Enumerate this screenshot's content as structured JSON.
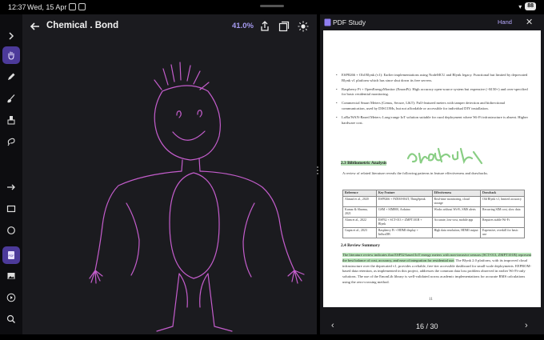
{
  "status": {
    "time": "12:37",
    "date": "Wed, 15 Apr",
    "battery": "88"
  },
  "toolbar": {
    "title": "Chemical . Bond",
    "zoom": "41.0%"
  },
  "tools": [
    {
      "name": "expand-icon"
    },
    {
      "name": "hand-icon",
      "active": true
    },
    {
      "name": "pen-icon"
    },
    {
      "name": "brush-icon"
    },
    {
      "name": "eraser-icon"
    },
    {
      "name": "lasso-icon"
    },
    {
      "name": "arrow-icon"
    },
    {
      "name": "rectangle-icon"
    },
    {
      "name": "circle-icon"
    },
    {
      "name": "pdf-icon"
    },
    {
      "name": "image-icon"
    },
    {
      "name": "play-icon"
    },
    {
      "name": "search-icon"
    }
  ],
  "colors": {
    "accent": "#a69bf0",
    "ink": "#c45dcc",
    "highlighter": "#74c66f",
    "active_tool": "#4c3a9a"
  },
  "panel": {
    "title": "PDF Study",
    "mode": "Hand",
    "close": "✕",
    "page_indicator": "16 / 30",
    "prev": "‹",
    "next": "›"
  },
  "pdf": {
    "bullets": [
      "ESP8266 + Old Blynk (v1): Earlier implementations using NodeMCU and Blynk legacy. Functional but limited by deprecated Blynk v1 platform which has since shut down its free servers.",
      "Raspberry Pi + OpenEnergyMonitor (EmonPi): High accuracy open-source system but expensive (~$150+) and over-specified for basic residential monitoring.",
      "Commercial Smart Meters (Genus, Secure, L&T): Full-featured meters with tamper detection and bidirectional communication, used by DISCOMs, but not affordable or accessible for individual DIY installation.",
      "LoRa/WAN-Based Meters: Long-range IoT solution suitable for rural deployment where Wi-Fi infrastructure is absent. Higher hardware cost."
    ],
    "section_23_title": "2.3  Bibliometric Analysis",
    "section_23_intro": "A review of related literature reveals the following patterns in feature effectiveness and drawbacks.",
    "table_headers": [
      "Reference",
      "Key Feature",
      "Effectiveness",
      "Drawback"
    ],
    "table_rows": [
      [
        "Ahmad et al., 2020",
        "ESP8266 + PZEM-004T, ThingSpeak",
        "Real-time monitoring, cloud storage",
        "Old Blynk v1, limited accuracy"
      ],
      [
        "Kumar & Sharma, 2021",
        "GSM + SIM800, Arduino",
        "Works without Wi-Fi, SMS alerts",
        "Recurring SIM cost, slow data"
      ],
      [
        "Alam et al., 2022",
        "ESP32 + SCT-013 + ZMPT101B + Blynk",
        "Accurate, low-cost, mobile app",
        "Requires stable Wi-Fi"
      ],
      [
        "Gupta et al., 2023",
        "Raspberry Pi + HDMI display + InfluxDB",
        "High data resolution, HDMI output",
        "Expensive, overkill for basic use"
      ]
    ],
    "section_24_title": "2.4  Review Summary",
    "summary_highlighted": "The literature review indicates that ESP32-based IoT energy meters with non-invasive sensors (SCT-013, ZMPT101B) represent the best balance of cost, accuracy, and ease of integration for residential use.",
    "summary_rest": "The Blynk 2.0 platform, with its improved cloud infrastructure over the deprecated v1, provides a reliable, free-tier accessible dashboard for small-scale deployments. EEPROM-based data retention, as implemented in this project, addresses the common data loss problem observed in earlier Wi-Fi-only solutions. The use of the EmonLib library is well-validated across academic implementations for accurate RMS calculations using the zero-crossing method.",
    "page_number": "11"
  }
}
